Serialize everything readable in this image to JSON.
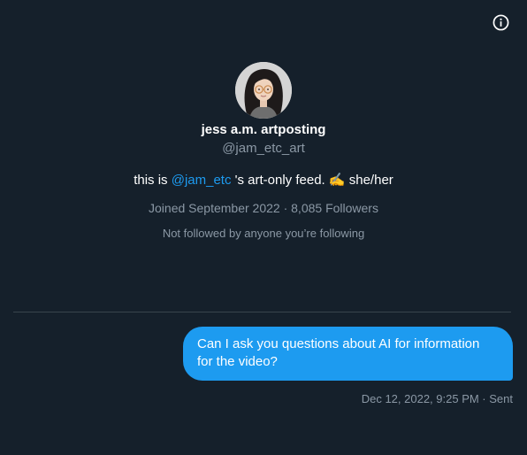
{
  "header": {
    "info_icon": "info-circle-icon"
  },
  "profile": {
    "display_name": "jess a.m. artposting",
    "handle": "@jam_etc_art",
    "bio_prefix": "this is ",
    "bio_mention": "@jam_etc",
    "bio_middle": " 's art-only feed. ",
    "bio_emoji": "✍️",
    "bio_suffix": " she/her",
    "joined": "Joined September 2022",
    "separator": " · ",
    "followers": "8,085 Followers",
    "followed_by": "Not followed by anyone you’re following"
  },
  "conversation": {
    "messages": [
      {
        "text": "Can I ask you questions about AI for information for the video?",
        "meta": "Dec 12, 2022, 9:25 PM · Sent"
      }
    ]
  },
  "colors": {
    "background": "#15202b",
    "accent": "#1d9bf0",
    "muted_text": "#8b98a5",
    "divider": "#38444d"
  }
}
